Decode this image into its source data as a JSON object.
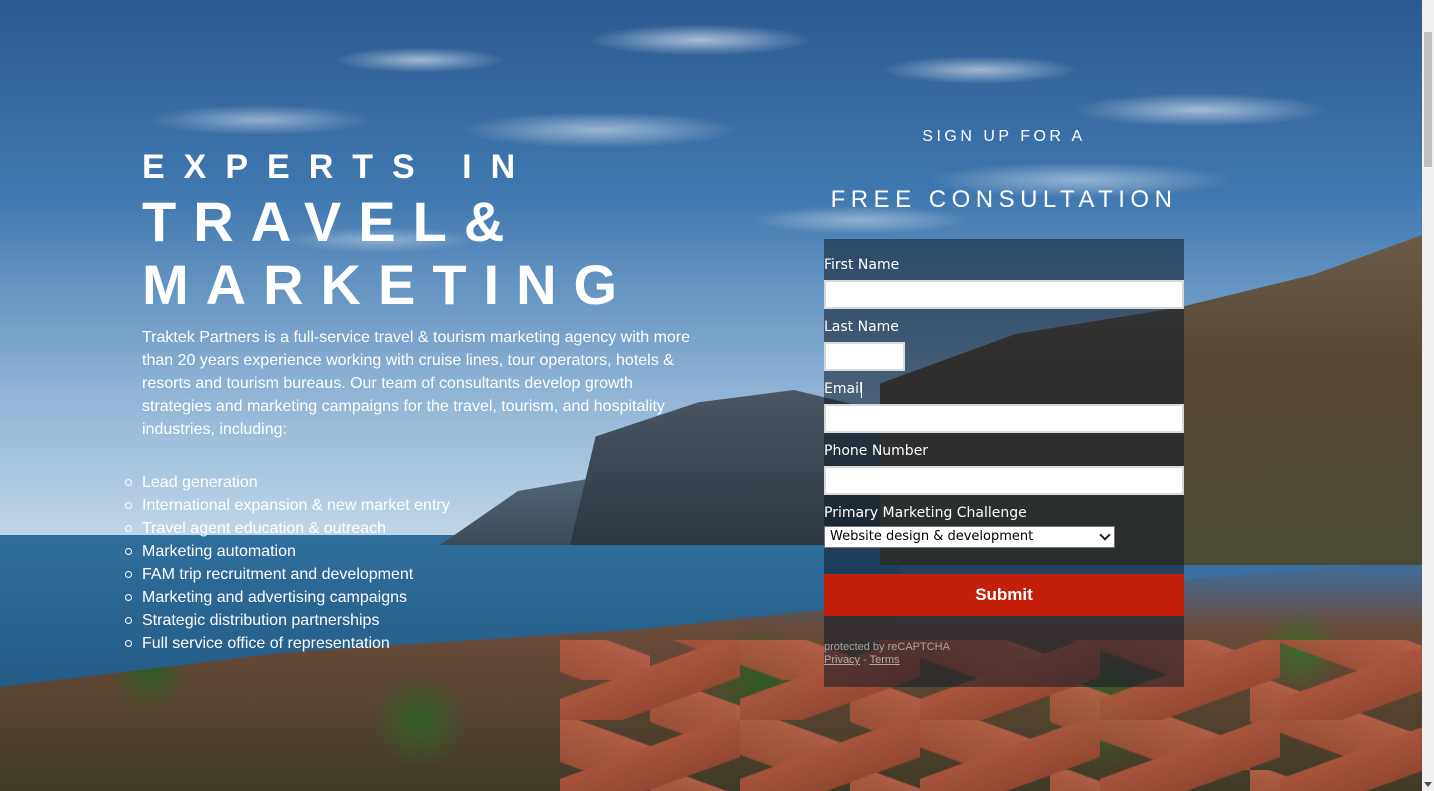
{
  "hero": {
    "kicker": "EXPERTS IN",
    "headline_line1": "TRAVEL&",
    "headline_line2": "MARKETING",
    "intro": "Traktek Partners is a full-service travel & tourism marketing agency with more than 20 years experience working with cruise lines, tour operators, hotels & resorts and tourism bureaus. Our team of consultants develop growth strategies and marketing campaigns for the travel, tourism, and hospitality industries, including:",
    "services": [
      "Lead generation",
      "International expansion & new market entry",
      "Travel agent education & outreach",
      "Marketing automation",
      "FAM trip recruitment and development",
      "Marketing and advertising campaigns",
      "Strategic distribution partnerships",
      "Full service office of representation"
    ]
  },
  "signup": {
    "top": "SIGN UP FOR A",
    "big": "FREE CONSULTATION"
  },
  "form": {
    "first_name_label": "First Name",
    "first_name_value": "",
    "last_name_label": "Last Name",
    "last_name_value": "",
    "email_label": "Email",
    "email_value": "",
    "phone_label": "Phone Number",
    "phone_value": "",
    "challenge_label": "Primary Marketing Challenge",
    "challenge_selected": "Website design & development",
    "submit_label": "Submit"
  },
  "recaptcha": {
    "protected_text": "protected by reCAPTCHA",
    "privacy": "Privacy",
    "separator": "-",
    "terms": "Terms"
  },
  "colors": {
    "submit": "#c41f0a",
    "panel": "rgba(15,25,40,.55)"
  }
}
